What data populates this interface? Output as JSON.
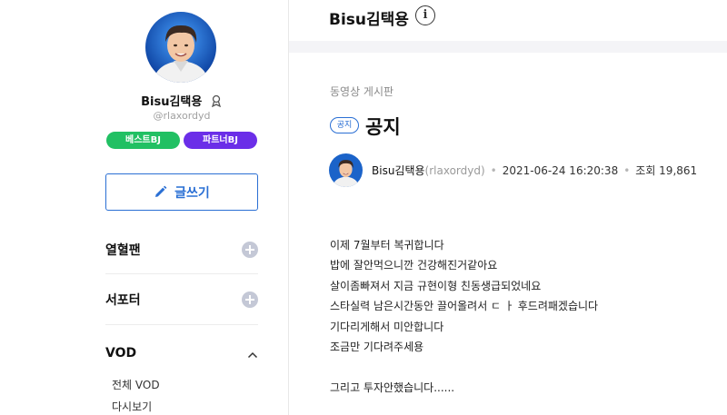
{
  "profile": {
    "nickname": "Bisu김택용",
    "user_id": "@rlaxordyd",
    "badges": {
      "best": "베스트BJ",
      "partner": "파트너BJ"
    }
  },
  "sidebar": {
    "write_label": "글쓰기",
    "menus": [
      {
        "label": "열혈팬"
      },
      {
        "label": "서포터"
      },
      {
        "label": "VOD"
      }
    ],
    "vod_sub": [
      "전체 VOD",
      "다시보기"
    ]
  },
  "header": {
    "title": "Bisu김택용"
  },
  "post": {
    "board": "동영상 게시판",
    "tag": "공지",
    "title": "공지",
    "author": "Bisu김택용",
    "author_id": "(rlaxordyd)",
    "date": "2021-06-24 16:20:38",
    "views": "조회 19,861",
    "lines": [
      "이제 7월부터 복귀합니다",
      "밥에 잘안먹으니깐 건강해진거같아요",
      "살이좀빠져서 지금 규현이형 친동생급되었네요",
      "스타실력 남은시간동안 끌어올려서 ㄷ ㅏ 후드려패겠습니다",
      "기다리게해서 미안합니다",
      "조금만 기다려주세용",
      "",
      "그리고 투자안했습니다......"
    ]
  },
  "colors": {
    "accent": "#2a6fd4",
    "best_badge": "#21c063",
    "partner_badge": "#6b2ee8",
    "plus_icon": "#c4c8d6"
  }
}
